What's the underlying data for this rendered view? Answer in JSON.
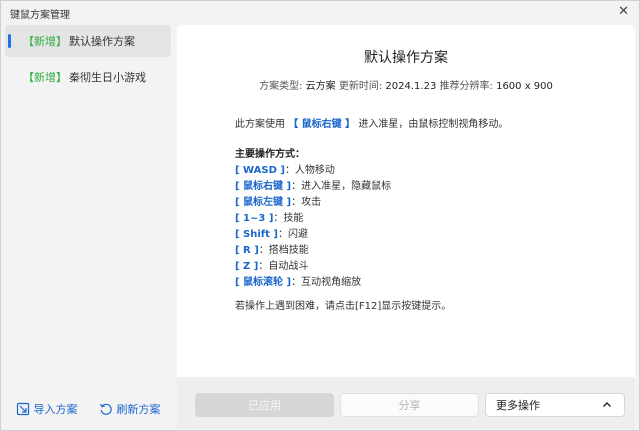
{
  "window": {
    "title": "键鼠方案管理",
    "close_glyph": "✕"
  },
  "sidebar": {
    "items": [
      {
        "tag": "【新增】",
        "label": "默认操作方案",
        "active": true
      },
      {
        "tag": "【新增】",
        "label": "秦彻生日小游戏",
        "active": false
      }
    ],
    "import_label": "导入方案",
    "refresh_label": "刷新方案"
  },
  "plan": {
    "title": "默认操作方案",
    "type_label": "方案类型:",
    "type_value": "云方案",
    "updated_label": "更新时间:",
    "updated_value": "2024.1.23",
    "resolution_label": "推荐分辨率:",
    "resolution_value": "1600 x 900",
    "intro_before": "此方案使用",
    "intro_key": "【 鼠标右键 】",
    "intro_after": "进入准星，由鼠标控制视角移动。",
    "controls_heading": "主要操作方式：",
    "controls": [
      {
        "key": "[ WASD ]",
        "desc": "：人物移动"
      },
      {
        "key": "[ 鼠标右键 ]",
        "desc": "：进入准星，隐藏鼠标"
      },
      {
        "key": "[ 鼠标左键 ]",
        "desc": "：攻击"
      },
      {
        "key": "[ 1~3 ]",
        "desc": "：技能"
      },
      {
        "key": "[ Shift ]",
        "desc": "：闪避"
      },
      {
        "key": "[ R ]",
        "desc": "：搭档技能"
      },
      {
        "key": "[ Z ]",
        "desc": "：自动战斗"
      },
      {
        "key": "[ 鼠标滚轮 ]",
        "desc": "：互动视角缩放"
      }
    ],
    "tip": "若操作上遇到困难，请点击[F12]显示按键提示。"
  },
  "footer": {
    "applied_label": "已应用",
    "share_label": "分享",
    "more_label": "更多操作",
    "more_icon": "chevron-up-icon"
  },
  "colors": {
    "accent": "#1a66cc",
    "tag_green": "#2eaf3f"
  }
}
